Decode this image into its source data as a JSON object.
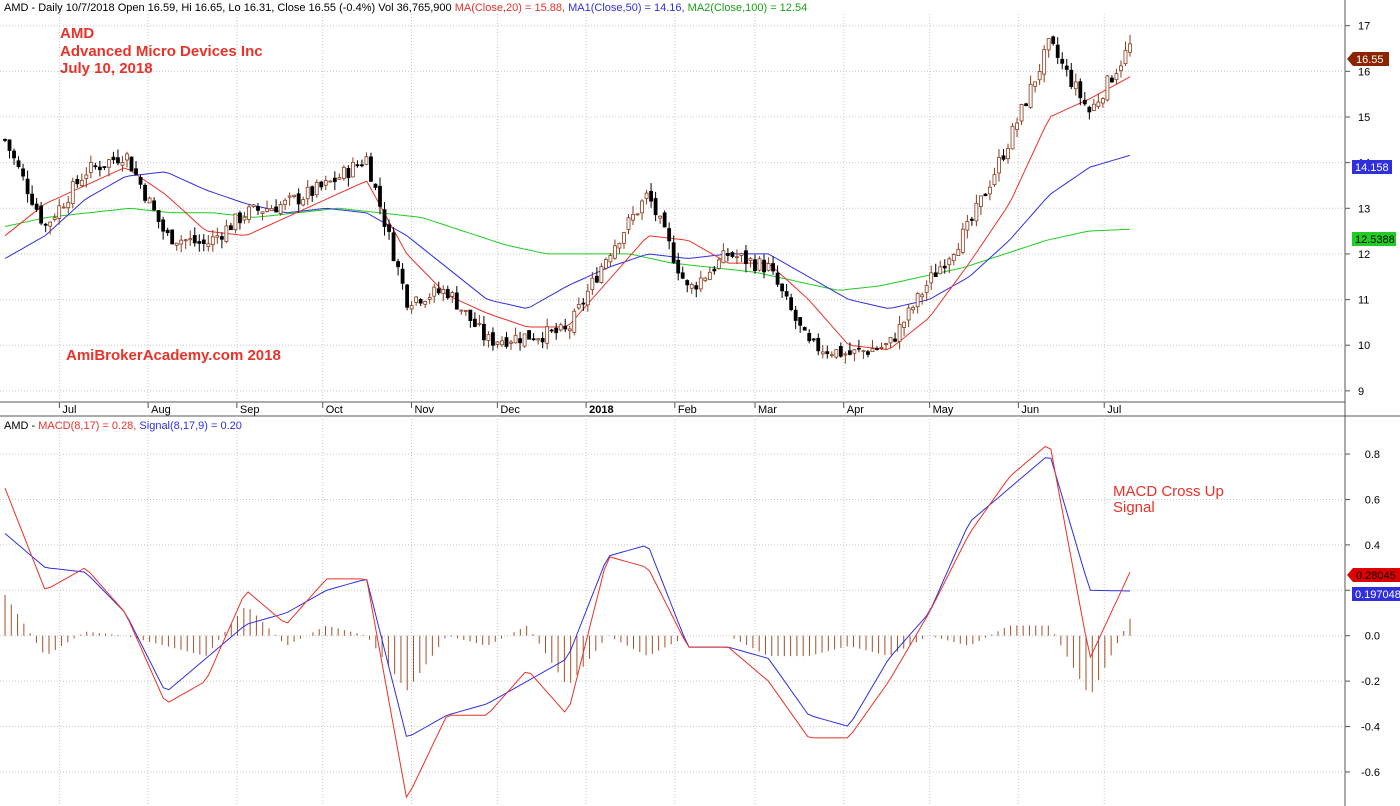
{
  "price_panel": {
    "header": {
      "base": "AMD - Daily 10/7/2018 Open 16.59, Hi 16.65, Lo 16.31, Close 16.55 (-0.4%) Vol 36,765,900 ",
      "ma20": "MA(Close,20) = 15.88,",
      "ma50": "MA1(Close,50) = 14.16,",
      "ma100": "MA2(Close,100) = 12.54"
    },
    "annotation": {
      "line1": "AMD",
      "line2": "Advanced Micro Devices Inc",
      "line3": "July 10, 2018",
      "watermark": "AmiBrokerAcademy.com  2018"
    },
    "y_ticks": [
      "17",
      "16",
      "15",
      "14",
      "13",
      "12",
      "11",
      "10",
      "9"
    ],
    "x_ticks": [
      "Jul",
      "Aug",
      "Sep",
      "Oct",
      "Nov",
      "Dec",
      "2018",
      "Feb",
      "Mar",
      "Apr",
      "May",
      "Jun",
      "Jul"
    ],
    "tags": {
      "close": "16.55",
      "ma50": "14.158",
      "ma100": "12.5388"
    }
  },
  "macd_panel": {
    "header": {
      "base": "AMD - ",
      "macd": "MACD(8,17) = 0.28,",
      "signal": "Signal(8,17,9) = 0.20"
    },
    "annotation": {
      "line1": "MACD Cross Up",
      "line2": "Signal"
    },
    "y_ticks": [
      "0.8",
      "0.6",
      "0.4",
      "0.2",
      "0.0",
      "-0.2",
      "-0.4",
      "-0.6"
    ],
    "tags": {
      "macd": "0.28045",
      "signal": "0.197048"
    }
  },
  "colors": {
    "up_candle": "#8b3a1a",
    "down_candle": "#000000",
    "ma20": "#e8322a",
    "ma50": "#2f2fe0",
    "ma100": "#22cc22",
    "histogram": "#a0522d",
    "tag_close": "#8b2500",
    "tag_ma50": "#2f2fe0",
    "tag_ma100": "#22cc22"
  },
  "chart_data": [
    {
      "type": "candlestick",
      "title": "AMD - Daily",
      "ylim": [
        8.8,
        17.3
      ],
      "grid": true,
      "x": [
        "2017-06-12",
        "2017-06-26",
        "2017-07-10",
        "2017-07-24",
        "2017-08-07",
        "2017-08-21",
        "2017-09-05",
        "2017-09-18",
        "2017-10-02",
        "2017-10-16",
        "2017-10-30",
        "2017-11-13",
        "2017-11-27",
        "2017-12-11",
        "2017-12-26",
        "2018-01-08",
        "2018-01-22",
        "2018-02-05",
        "2018-02-20",
        "2018-03-05",
        "2018-03-19",
        "2018-04-02",
        "2018-04-16",
        "2018-04-30",
        "2018-05-14",
        "2018-05-29",
        "2018-06-11",
        "2018-06-25",
        "2018-07-10"
      ],
      "series": [
        {
          "name": "Close",
          "values": [
            14.5,
            12.6,
            13.8,
            14.2,
            12.4,
            12.2,
            12.9,
            13.1,
            13.5,
            14.1,
            11.0,
            11.2,
            10.1,
            10.2,
            10.3,
            12.0,
            13.3,
            11.2,
            12.0,
            11.7,
            10.0,
            9.8,
            10.0,
            11.4,
            12.6,
            14.5,
            16.6,
            15.1,
            16.55
          ]
        },
        {
          "name": "MA(Close,20)",
          "values": [
            12.4,
            13.1,
            13.5,
            13.9,
            13.3,
            12.5,
            12.4,
            12.8,
            13.2,
            13.6,
            12.0,
            11.1,
            10.7,
            10.4,
            10.4,
            11.4,
            12.4,
            12.3,
            11.8,
            11.8,
            11.0,
            10.0,
            9.9,
            10.6,
            11.8,
            13.1,
            15.0,
            15.4,
            15.88
          ]
        },
        {
          "name": "MA1(Close,50)",
          "values": [
            11.9,
            12.4,
            13.2,
            13.7,
            13.8,
            13.4,
            13.1,
            12.9,
            13.0,
            12.9,
            12.4,
            11.7,
            11.0,
            10.8,
            11.3,
            11.7,
            12.0,
            11.9,
            12.0,
            12.0,
            11.5,
            11.0,
            10.8,
            11.0,
            11.5,
            12.3,
            13.3,
            13.9,
            14.16
          ]
        },
        {
          "name": "MA2(Close,100)",
          "values": [
            12.6,
            12.8,
            12.9,
            13.0,
            12.9,
            12.9,
            12.8,
            12.9,
            13.0,
            12.9,
            12.8,
            12.5,
            12.2,
            12.0,
            12.0,
            12.0,
            11.8,
            11.7,
            11.6,
            11.4,
            11.2,
            11.3,
            11.5,
            11.7,
            12.0,
            12.3,
            12.5,
            12.54
          ]
        }
      ]
    },
    {
      "type": "line",
      "title": "MACD(8,17) / Signal(8,17,9)",
      "ylim": [
        -0.75,
        0.95
      ],
      "grid": true,
      "x": [
        "2017-06-12",
        "2017-06-26",
        "2017-07-10",
        "2017-07-24",
        "2017-08-07",
        "2017-08-21",
        "2017-09-05",
        "2017-09-18",
        "2017-10-02",
        "2017-10-16",
        "2017-10-30",
        "2017-11-13",
        "2017-11-27",
        "2017-12-11",
        "2017-12-26",
        "2018-01-08",
        "2018-01-22",
        "2018-02-05",
        "2018-02-20",
        "2018-03-05",
        "2018-03-19",
        "2018-04-02",
        "2018-04-16",
        "2018-04-30",
        "2018-05-14",
        "2018-05-29",
        "2018-06-11",
        "2018-06-25",
        "2018-07-10"
      ],
      "series": [
        {
          "name": "MACD(8,17)",
          "values": [
            0.65,
            0.2,
            0.3,
            0.1,
            -0.3,
            -0.2,
            0.2,
            0.05,
            0.25,
            0.25,
            -0.72,
            -0.35,
            -0.35,
            -0.15,
            -0.35,
            0.35,
            0.3,
            -0.05,
            -0.05,
            -0.2,
            -0.45,
            -0.45,
            -0.2,
            0.1,
            0.45,
            0.7,
            0.85,
            -0.1,
            0.28
          ]
        },
        {
          "name": "Signal(8,17,9)",
          "values": [
            0.45,
            0.3,
            0.28,
            0.1,
            -0.25,
            -0.1,
            0.05,
            0.1,
            0.2,
            0.25,
            -0.45,
            -0.35,
            -0.3,
            -0.2,
            -0.1,
            0.35,
            0.4,
            -0.05,
            -0.05,
            -0.1,
            -0.35,
            -0.4,
            -0.1,
            0.1,
            0.5,
            0.65,
            0.8,
            0.2,
            0.197
          ]
        }
      ]
    }
  ]
}
